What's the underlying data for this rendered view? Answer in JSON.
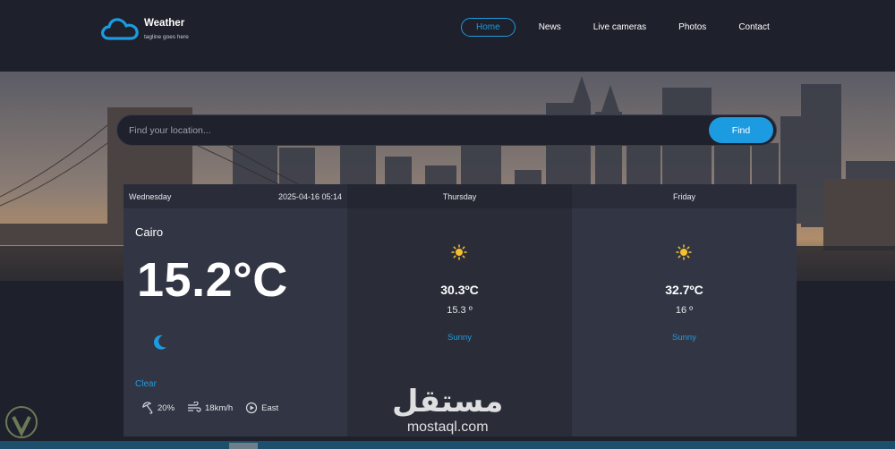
{
  "header": {
    "brand": "Weather",
    "tagline": "tagline goes here",
    "logo_icon": "cloud-icon"
  },
  "nav": {
    "items": [
      {
        "label": "Home",
        "active": true
      },
      {
        "label": "News",
        "active": false
      },
      {
        "label": "Live cameras",
        "active": false
      },
      {
        "label": "Photos",
        "active": false
      },
      {
        "label": "Contact",
        "active": false
      }
    ]
  },
  "search": {
    "placeholder": "Find your location...",
    "button_label": "Find"
  },
  "today": {
    "day": "Wednesday",
    "datetime": "2025-04-16 05:14",
    "city": "Cairo",
    "temp": "15.2°C",
    "icon": "moon-icon",
    "condition": "Clear",
    "humidity": "20%",
    "wind_speed": "18km/h",
    "wind_direction": "East"
  },
  "forecast": [
    {
      "day": "Thursday",
      "icon": "sun-icon",
      "high": "30.3ºC",
      "low": "15.3 º",
      "condition": "Sunny"
    },
    {
      "day": "Friday",
      "icon": "sun-icon",
      "high": "32.7ºC",
      "low": "16 º",
      "condition": "Sunny"
    }
  ],
  "watermark": {
    "arabic": "مستقل",
    "latin": "mostaql.com"
  },
  "colors": {
    "accent": "#1d9be0",
    "background": "#1e202b",
    "card": "#323644",
    "card_alt": "#2a2d38"
  }
}
